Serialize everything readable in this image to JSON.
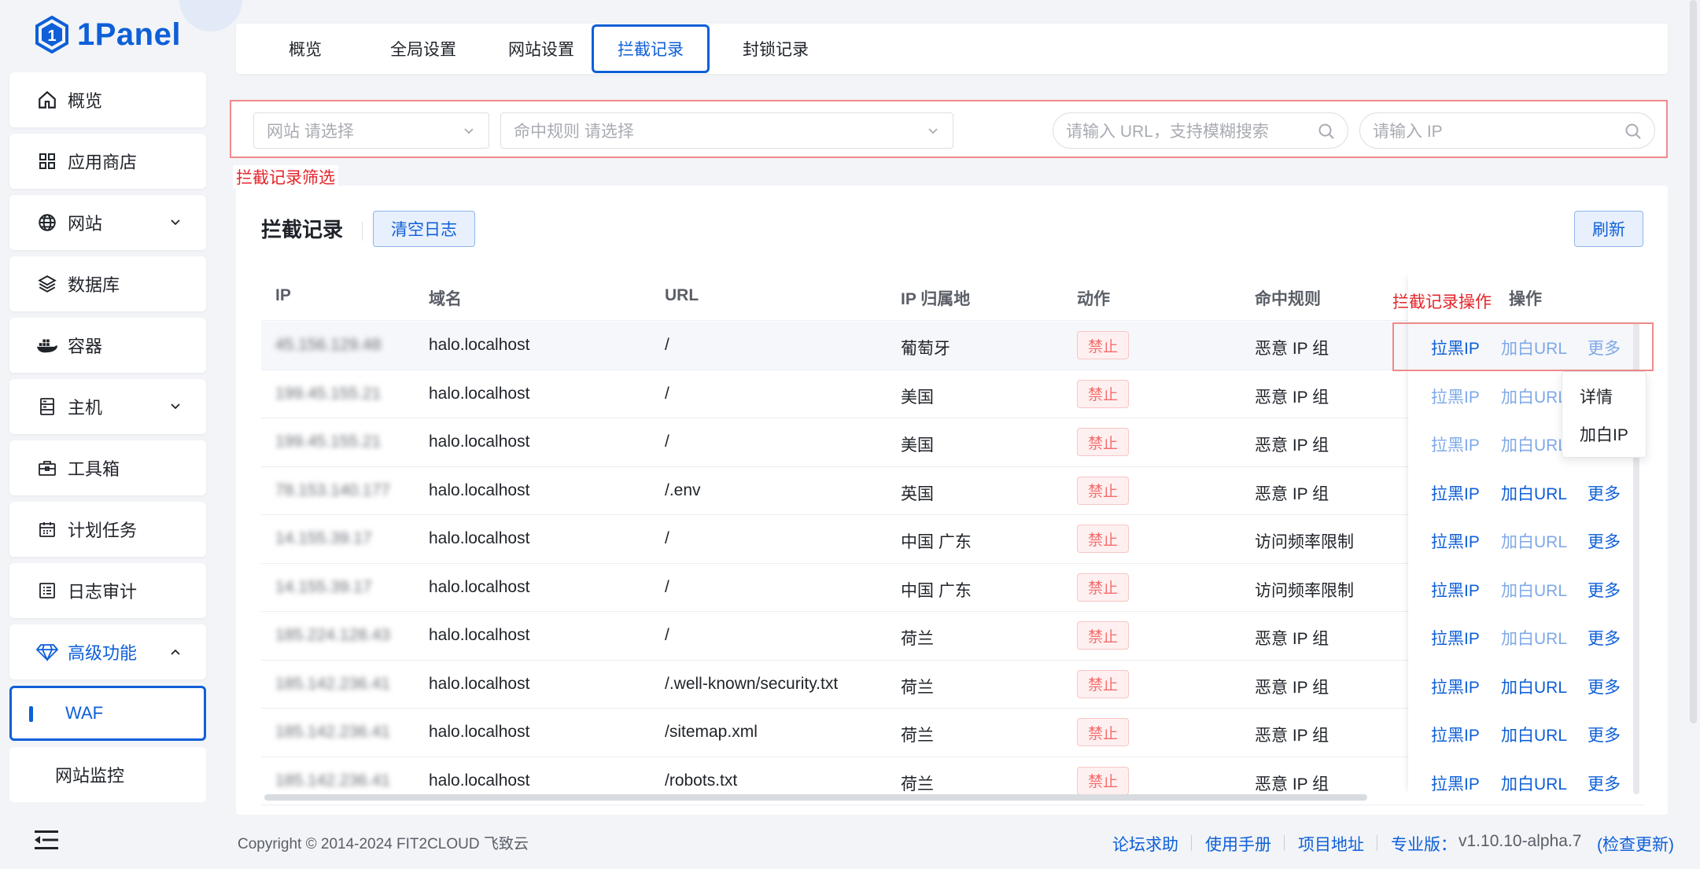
{
  "app": {
    "logo_text": "1Panel"
  },
  "sidebar": {
    "items": [
      {
        "label": "概览"
      },
      {
        "label": "应用商店"
      },
      {
        "label": "网站"
      },
      {
        "label": "数据库"
      },
      {
        "label": "容器"
      },
      {
        "label": "主机"
      },
      {
        "label": "工具箱"
      },
      {
        "label": "计划任务"
      },
      {
        "label": "日志审计"
      },
      {
        "label": "高级功能"
      }
    ],
    "sub_items": [
      {
        "label": "WAF"
      },
      {
        "label": "网站监控"
      }
    ]
  },
  "tabs": [
    {
      "label": "概览"
    },
    {
      "label": "全局设置"
    },
    {
      "label": "网站设置"
    },
    {
      "label": "拦截记录"
    },
    {
      "label": "封锁记录"
    }
  ],
  "filter": {
    "website_placeholder": "网站 请选择",
    "rule_placeholder": "命中规则 请选择",
    "url_placeholder": "请输入 URL，支持模糊搜索",
    "ip_placeholder": "请输入 IP",
    "annotation": "拦截记录筛选"
  },
  "card": {
    "title": "拦截记录",
    "clear_button": "清空日志",
    "refresh_button": "刷新",
    "ops_annotation": "拦截记录操作"
  },
  "table": {
    "headers": {
      "ip": "IP",
      "domain": "域名",
      "url": "URL",
      "geo": "IP 归属地",
      "action": "动作",
      "rule": "命中规则",
      "ops": "操作"
    },
    "rows": [
      {
        "ip": "45.156.129.48",
        "domain": "halo.localhost",
        "url": "/",
        "geo": "葡萄牙",
        "action": "禁止",
        "rule": "恶意 IP 组"
      },
      {
        "ip": "199.45.155.21",
        "domain": "halo.localhost",
        "url": "/",
        "geo": "美国",
        "action": "禁止",
        "rule": "恶意 IP 组"
      },
      {
        "ip": "199.45.155.21",
        "domain": "halo.localhost",
        "url": "/",
        "geo": "美国",
        "action": "禁止",
        "rule": "恶意 IP 组"
      },
      {
        "ip": "78.153.140.177",
        "domain": "halo.localhost",
        "url": "/.env",
        "geo": "英国",
        "action": "禁止",
        "rule": "恶意 IP 组"
      },
      {
        "ip": "14.155.39.17",
        "domain": "halo.localhost",
        "url": "/",
        "geo": "中国 广东",
        "action": "禁止",
        "rule": "访问频率限制"
      },
      {
        "ip": "14.155.39.17",
        "domain": "halo.localhost",
        "url": "/",
        "geo": "中国 广东",
        "action": "禁止",
        "rule": "访问频率限制"
      },
      {
        "ip": "185.224.128.43",
        "domain": "halo.localhost",
        "url": "/",
        "geo": "荷兰",
        "action": "禁止",
        "rule": "恶意 IP 组"
      },
      {
        "ip": "185.142.236.41",
        "domain": "halo.localhost",
        "url": "/.well-known/security.txt",
        "geo": "荷兰",
        "action": "禁止",
        "rule": "恶意 IP 组"
      },
      {
        "ip": "185.142.236.41",
        "domain": "halo.localhost",
        "url": "/sitemap.xml",
        "geo": "荷兰",
        "action": "禁止",
        "rule": "恶意 IP 组"
      },
      {
        "ip": "185.142.236.41",
        "domain": "halo.localhost",
        "url": "/robots.txt",
        "geo": "荷兰",
        "action": "禁止",
        "rule": "恶意 IP 组"
      }
    ],
    "op_labels": {
      "blacklist_ip": "拉黑IP",
      "whitelist_url": "加白URL",
      "more": "更多"
    }
  },
  "dropdown": {
    "items": [
      {
        "label": "详情"
      },
      {
        "label": "加白IP"
      }
    ]
  },
  "footer": {
    "copyright": "Copyright © 2014-2024 FIT2CLOUD 飞致云",
    "links": [
      {
        "label": "论坛求助"
      },
      {
        "label": "使用手册"
      },
      {
        "label": "项目地址"
      }
    ],
    "edition": "专业版：",
    "version": "v1.10.10-alpha.7",
    "check_update": "(检查更新)"
  },
  "colors": {
    "primary": "#0e5fd8",
    "danger": "#f56c6c",
    "annotation": "#e5252a"
  }
}
